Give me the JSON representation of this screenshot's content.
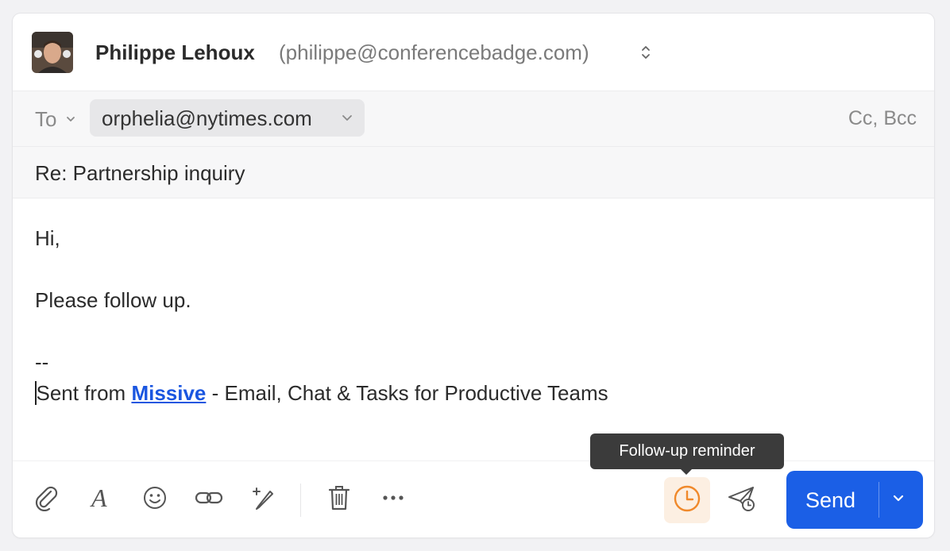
{
  "from": {
    "name": "Philippe Lehoux",
    "email": "(philippe@conferencebadge.com)"
  },
  "to": {
    "label": "To",
    "recipient": "orphelia@nytimes.com",
    "cc_bcc": "Cc, Bcc"
  },
  "subject": "Re: Partnership inquiry",
  "body": {
    "greeting": "Hi,",
    "message": "Please follow up.",
    "sig_separator": "--",
    "sig_prefix": "Sent from ",
    "sig_link": "Missive",
    "sig_suffix": " - Email, Chat & Tasks for Productive Teams"
  },
  "toolbar": {
    "send_label": "Send",
    "tooltip": "Follow-up reminder",
    "icons": [
      "attachment-icon",
      "format-text-icon",
      "emoji-icon",
      "link-icon",
      "signature-icon",
      "trash-icon",
      "more-icon",
      "clock-icon",
      "send-later-icon",
      "chevron-down-icon"
    ]
  },
  "colors": {
    "accent": "#1b5fe6",
    "reminder_highlight": "#fcefe2",
    "reminder_icon": "#f0892b",
    "link": "#1a56e0"
  }
}
